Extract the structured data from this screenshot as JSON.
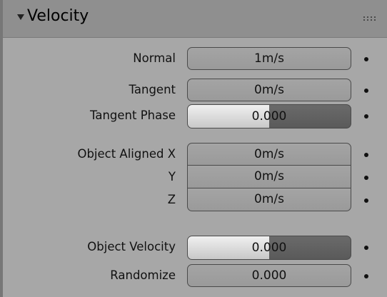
{
  "panel": {
    "title": "Velocity"
  },
  "fields": {
    "normal": {
      "label": "Normal",
      "value": "1m/s"
    },
    "tangent": {
      "label": "Tangent",
      "value": "0m/s"
    },
    "tangent_phase": {
      "label": "Tangent Phase",
      "value": "0.000",
      "fill_fraction": 0.5
    },
    "object_aligned_x": {
      "label": "Object Aligned X",
      "value": "0m/s"
    },
    "object_aligned_y": {
      "label": "Y",
      "value": "0m/s"
    },
    "object_aligned_z": {
      "label": "Z",
      "value": "0m/s"
    },
    "object_velocity": {
      "label": "Object Velocity",
      "value": "0.000",
      "fill_fraction": 0.5
    },
    "randomize": {
      "label": "Randomize",
      "value": "0.000"
    }
  }
}
